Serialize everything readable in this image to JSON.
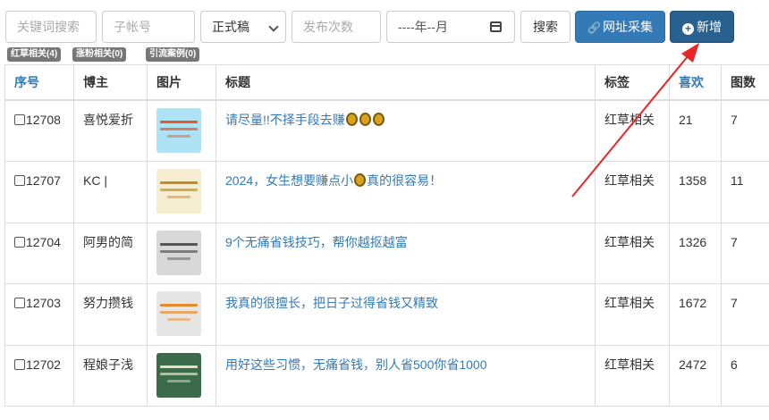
{
  "filters": {
    "keyword_placeholder": "关键词搜索",
    "subaccount_placeholder": "子帐号",
    "status_selected": "正式稿",
    "publish_count_placeholder": "发布次数",
    "month_value": "----年--月",
    "search_label": "搜索",
    "collect_label": "网址采集",
    "add_label": "新增"
  },
  "tags": [
    {
      "label": "红草相关(4)"
    },
    {
      "label": "涨粉相关(0)"
    },
    {
      "label": "引流案例(0)"
    }
  ],
  "table": {
    "headers": {
      "id": "序号",
      "author": "博主",
      "image": "图片",
      "title": "标题",
      "tag": "标签",
      "likes": "喜欢",
      "pics": "图数"
    },
    "rows": [
      {
        "id": "12708",
        "author": "喜悦爱折",
        "title": "请尽量!!不择手段去赚",
        "medals": 3,
        "title_tail": "",
        "tag": "红草相关",
        "likes": "21",
        "pics": "7",
        "thumb_bg": "#aee3f5",
        "thumb_fg": "#e05a2a"
      },
      {
        "id": "12707",
        "author": "KC |",
        "title": "2024，女生想要赚点小",
        "medals": 1,
        "title_tail": "真的很容易！",
        "tag": "红草相关",
        "likes": "1358",
        "pics": "11",
        "thumb_bg": "#f6edd0",
        "thumb_fg": "#c48b1d"
      },
      {
        "id": "12704",
        "author": "阿男的简",
        "title": "9个无痛省钱技巧，帮你越抠越富",
        "medals": 0,
        "title_tail": "",
        "tag": "红草相关",
        "likes": "1326",
        "pics": "7",
        "thumb_bg": "#d8d8d8",
        "thumb_fg": "#555555"
      },
      {
        "id": "12703",
        "author": "努力攒钱",
        "title": "我真的很擅长，把日子过得省钱又精致",
        "medals": 0,
        "title_tail": "",
        "tag": "红草相关",
        "likes": "1672",
        "pics": "7",
        "thumb_bg": "#e6e6e6",
        "thumb_fg": "#e88a2c"
      },
      {
        "id": "12702",
        "author": "程娘子浅",
        "title": "用好这些习惯，无痛省钱，别人省500你省1000",
        "medals": 0,
        "title_tail": "",
        "tag": "红草相关",
        "likes": "2472",
        "pics": "6",
        "thumb_bg": "#3c6b4c",
        "thumb_fg": "#e8e0c0"
      }
    ]
  },
  "colors": {
    "primary": "#337ab7",
    "primary_active": "#286090",
    "arrow": "#e8262a",
    "tag_gray": "#777777"
  }
}
